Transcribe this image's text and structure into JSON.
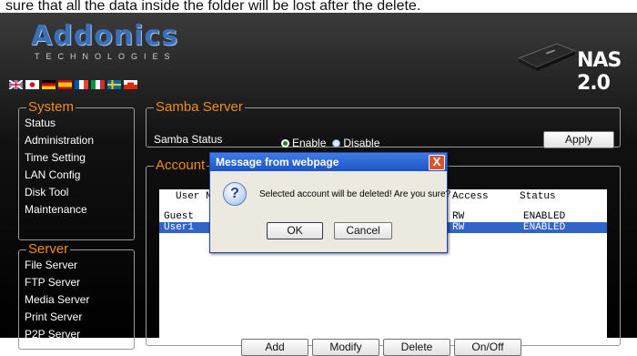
{
  "top_text": "sure that all the data inside the folder will be lost after the delete.",
  "brand": {
    "name": "Addonics",
    "sub": "TECHNOLOGIES"
  },
  "model": "NAS 2.0",
  "flags": [
    {
      "name": "uk-flag-icon",
      "colors": [
        "#2a3f8f",
        "#ffffff",
        "#c8102e"
      ]
    },
    {
      "name": "japan-flag-icon",
      "colors": [
        "#ffffff",
        "#c8102e",
        "#ffffff"
      ]
    },
    {
      "name": "germany-flag-icon",
      "colors": [
        "#000000",
        "#dd0000",
        "#ffce00"
      ]
    },
    {
      "name": "spain-flag-icon",
      "colors": [
        "#c60b1e",
        "#ffc400",
        "#c60b1e"
      ]
    },
    {
      "name": "france-flag-icon",
      "colors": [
        "#0055a4",
        "#ffffff",
        "#ef4135"
      ]
    },
    {
      "name": "italy-flag-icon",
      "colors": [
        "#009246",
        "#ffffff",
        "#ce2b37"
      ]
    },
    {
      "name": "sweden-flag-icon",
      "colors": [
        "#006aa7",
        "#fecc00",
        "#006aa7"
      ]
    },
    {
      "name": "chinese-flag-icon",
      "colors": [
        "#ffffff",
        "#ffffff",
        "#de2910"
      ]
    }
  ],
  "system": {
    "legend": "System",
    "items": [
      "Status",
      "Administration",
      "Time Setting",
      "LAN Config",
      "Disk Tool",
      "Maintenance"
    ]
  },
  "server": {
    "legend": "Server",
    "items": [
      "File Server",
      "FTP Server",
      "Media Server",
      "Print Server",
      "P2P Server"
    ]
  },
  "samba": {
    "legend": "Samba Server",
    "status_label": "Samba Status",
    "enable": "Enable",
    "disable": "Disable",
    "apply": "Apply"
  },
  "account": {
    "legend": "Account",
    "columns": [
      "User N",
      "Access",
      "Status"
    ],
    "rows": [
      {
        "user": "Guest",
        "access": "RW",
        "status": "ENABLED",
        "selected": false
      },
      {
        "user": "User1",
        "access": "RW",
        "status": "ENABLED",
        "selected": true
      }
    ],
    "buttons": [
      "Add",
      "Modify",
      "Delete",
      "On/Off"
    ]
  },
  "dialog": {
    "title": "Message from webpage",
    "message": "Selected account will be deleted! Are you sure?",
    "ok": "OK",
    "cancel": "Cancel",
    "close": "X"
  },
  "colors": {
    "accent": "#f28c1c",
    "selection": "#3164c8",
    "titlebar": "#1d54c7"
  }
}
